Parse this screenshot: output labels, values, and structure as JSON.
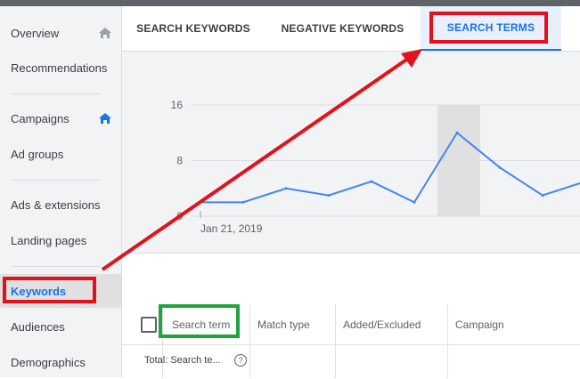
{
  "sidebar": {
    "items": [
      {
        "label": "Overview",
        "icon": "home-icon"
      },
      {
        "label": "Recommendations"
      },
      {
        "label": "Campaigns",
        "icon": "home-icon"
      },
      {
        "label": "Ad groups"
      },
      {
        "label": "Ads & extensions"
      },
      {
        "label": "Landing pages"
      },
      {
        "label": "Keywords"
      },
      {
        "label": "Audiences"
      },
      {
        "label": "Demographics"
      }
    ]
  },
  "tabs": [
    {
      "label": "SEARCH KEYWORDS"
    },
    {
      "label": "NEGATIVE KEYWORDS"
    },
    {
      "label": "SEARCH TERMS",
      "active": true
    }
  ],
  "chart_data": {
    "type": "line",
    "y_ticks": [
      "16",
      "8",
      "0"
    ],
    "ylim": [
      0,
      16
    ],
    "x_label_first": "Jan 21, 2019",
    "values": [
      2,
      2,
      4,
      3,
      5,
      2,
      12,
      7,
      3,
      5
    ],
    "highlighted_point_index": 5
  },
  "table": {
    "columns": [
      "Search term",
      "Match type",
      "Added/Excluded",
      "Campaign"
    ],
    "total_label": "Total: Search te...",
    "help_glyph": "?"
  },
  "colors": {
    "accent": "#1a73e8",
    "annotation_red": "#e3111b",
    "annotation_green": "#1fa43e"
  }
}
